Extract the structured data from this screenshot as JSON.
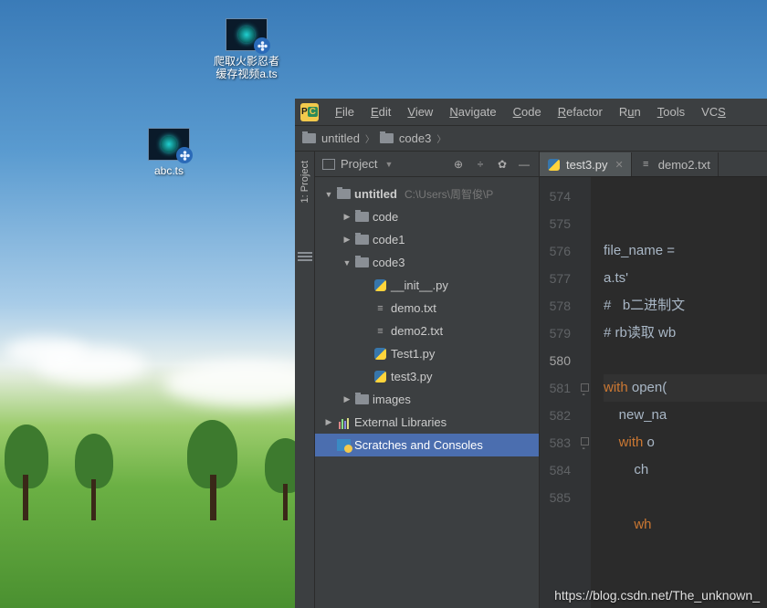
{
  "desktop": {
    "icons": [
      {
        "label": "爬取火影忍者\n缓存视频a.ts"
      },
      {
        "label": "abc.ts"
      }
    ]
  },
  "ide": {
    "app_icon": "PC",
    "menubar": [
      "File",
      "Edit",
      "View",
      "Navigate",
      "Code",
      "Refactor",
      "Run",
      "Tools",
      "VCS"
    ],
    "breadcrumb": [
      "untitled",
      "code3"
    ],
    "sidebar": {
      "project_tab": "1: Project"
    },
    "project_panel": {
      "title": "Project",
      "tree": {
        "root": {
          "name": "untitled",
          "hint": "C:\\Users\\周智俊\\P"
        },
        "node_code": "code",
        "node_code1": "code1",
        "node_code3": "code3",
        "file_init": "__init__.py",
        "file_demo": "demo.txt",
        "file_demo2": "demo2.txt",
        "file_test1": "Test1.py",
        "file_test3": "test3.py",
        "node_images": "images",
        "ext_lib": "External Libraries",
        "scratches": "Scratches and Consoles"
      }
    },
    "editor": {
      "tabs": [
        {
          "name": "test3.py",
          "icon": "py",
          "active": true
        },
        {
          "name": "demo2.txt",
          "icon": "txt",
          "active": false
        }
      ],
      "line_numbers": [
        "574",
        "575",
        "576",
        "",
        "577",
        "578",
        "579",
        "580",
        "581",
        "582",
        "583",
        "584",
        "585"
      ],
      "current_line": "580",
      "code": {
        "l576a": "file_name ",
        "l576b": "a.ts'",
        "l577": "#   b二进制文",
        "l578": "# rb读取 wb",
        "l580_with": "with",
        "l580_open": " open(",
        "l581": "new_na",
        "l582_with": "with",
        "l582_op": " o",
        "l583": "ch",
        "l585": "wh"
      }
    }
  },
  "watermark": "https://blog.csdn.net/The_unknown_"
}
